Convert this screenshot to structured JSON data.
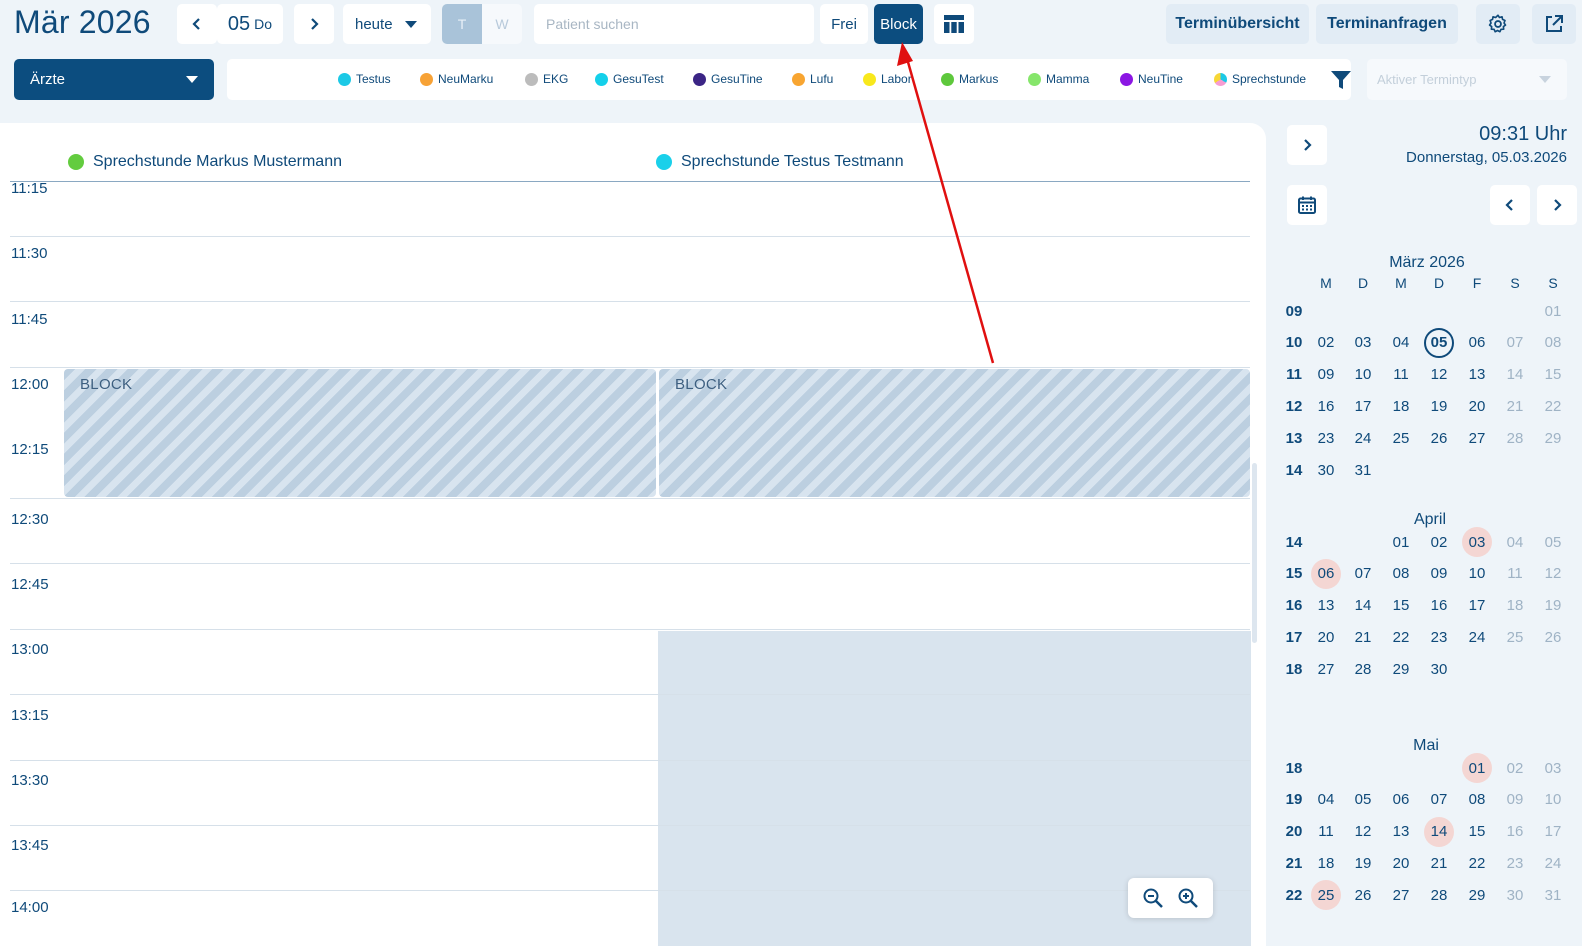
{
  "header": {
    "title": "Mär 2026",
    "date_num": "05",
    "date_day": "Do",
    "view_select": "heute",
    "view_t": "T",
    "view_w": "W",
    "search_placeholder": "Patient suchen",
    "frei_label": "Frei",
    "block_label": "Block",
    "terminuebersicht": "Terminübersicht",
    "terminanfragen": "Terminanfragen"
  },
  "filter": {
    "aerzte_label": "Ärzte",
    "termintyp_placeholder": "Aktiver Termintyp",
    "legend": [
      {
        "label": "Testus",
        "color": "#1cc9e6"
      },
      {
        "label": "NeuMarku",
        "color": "#f7a236"
      },
      {
        "label": "EKG",
        "color": "#bcbcbc"
      },
      {
        "label": "GesuTest",
        "color": "#14d0ea"
      },
      {
        "label": "GesuTine",
        "color": "#3b2585"
      },
      {
        "label": "Lufu",
        "color": "#f8a531"
      },
      {
        "label": "Labor",
        "color": "#f8e81c"
      },
      {
        "label": "Markus",
        "color": "#5ec83c"
      },
      {
        "label": "Mamma",
        "color": "#86e66b"
      },
      {
        "label": "NeuTine",
        "color": "#8b16e3"
      },
      {
        "label": "Sprechstunde",
        "color": "multi"
      }
    ]
  },
  "calendar": {
    "columns": [
      {
        "label": "Sprechstunde Markus Mustermann",
        "color": "#63cc3f"
      },
      {
        "label": "Sprechstunde Testus Testmann",
        "color": "#1ad0ea"
      }
    ],
    "times": [
      "11:15",
      "11:30",
      "11:45",
      "12:00",
      "12:15",
      "12:30",
      "12:45",
      "13:00",
      "13:15",
      "13:30",
      "13:45",
      "14:00"
    ],
    "block_label_left": "BLOCK",
    "block_label_right": "BLOCK"
  },
  "sidebar": {
    "clock": "09:31 Uhr",
    "date": "Donnerstag, 05.03.2026",
    "weekdays": [
      "M",
      "D",
      "M",
      "D",
      "F",
      "S",
      "S"
    ],
    "months": [
      {
        "title": "März 2026",
        "weeks": [
          {
            "kw": "09",
            "days": [
              "",
              "",
              "",
              "",
              "",
              "",
              "01"
            ]
          },
          {
            "kw": "10",
            "days": [
              "02",
              "03",
              "04",
              "05",
              "06",
              "07",
              "08"
            ]
          },
          {
            "kw": "11",
            "days": [
              "09",
              "10",
              "11",
              "12",
              "13",
              "14",
              "15"
            ]
          },
          {
            "kw": "12",
            "days": [
              "16",
              "17",
              "18",
              "19",
              "20",
              "21",
              "22"
            ]
          },
          {
            "kw": "13",
            "days": [
              "23",
              "24",
              "25",
              "26",
              "27",
              "28",
              "29"
            ]
          },
          {
            "kw": "14",
            "days": [
              "30",
              "31",
              "",
              "",
              "",
              "",
              ""
            ]
          }
        ]
      },
      {
        "title": "April",
        "weeks": [
          {
            "kw": "14",
            "days": [
              "",
              "",
              "01",
              "02",
              "03",
              "04",
              "05"
            ]
          },
          {
            "kw": "15",
            "days": [
              "06",
              "07",
              "08",
              "09",
              "10",
              "11",
              "12"
            ]
          },
          {
            "kw": "16",
            "days": [
              "13",
              "14",
              "15",
              "16",
              "17",
              "18",
              "19"
            ]
          },
          {
            "kw": "17",
            "days": [
              "20",
              "21",
              "22",
              "23",
              "24",
              "25",
              "26"
            ]
          },
          {
            "kw": "18",
            "days": [
              "27",
              "28",
              "29",
              "30",
              "",
              "",
              ""
            ]
          }
        ]
      },
      {
        "title": "Mai",
        "weeks": [
          {
            "kw": "18",
            "days": [
              "",
              "",
              "",
              "",
              "01",
              "02",
              "03"
            ]
          },
          {
            "kw": "19",
            "days": [
              "04",
              "05",
              "06",
              "07",
              "08",
              "09",
              "10"
            ]
          },
          {
            "kw": "20",
            "days": [
              "11",
              "12",
              "13",
              "14",
              "15",
              "16",
              "17"
            ]
          },
          {
            "kw": "21",
            "days": [
              "18",
              "19",
              "20",
              "21",
              "22",
              "23",
              "24"
            ]
          },
          {
            "kw": "22",
            "days": [
              "25",
              "26",
              "27",
              "28",
              "29",
              "30",
              "31"
            ]
          }
        ]
      }
    ],
    "today": "05",
    "holidays": {
      "April": [
        "03",
        "06"
      ],
      "Mai": [
        "01",
        "14",
        "25"
      ]
    }
  }
}
